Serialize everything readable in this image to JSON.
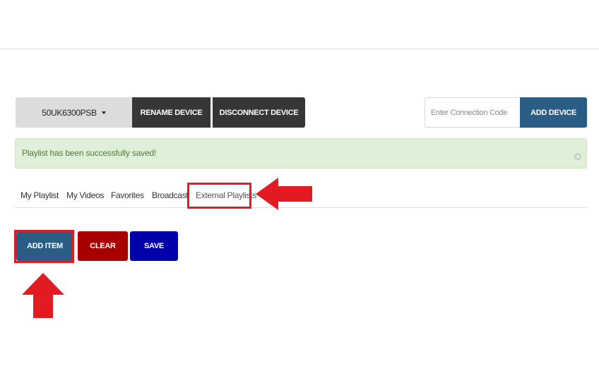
{
  "toolbar": {
    "device_name": "50UK6300PSB",
    "rename_label": "RENAME DEVICE",
    "disconnect_label": "DISCONNECT DEVICE",
    "connection_placeholder": "Enter Connection Code",
    "connection_value": "",
    "add_device_label": "ADD DEVICE"
  },
  "alert": {
    "message": "Playlist has been successfully saved!"
  },
  "tabs": [
    {
      "label": "My Playlist"
    },
    {
      "label": "My Videos"
    },
    {
      "label": "Favorites"
    },
    {
      "label": "Broadcast"
    },
    {
      "label": "External Playlists",
      "active": true
    }
  ],
  "actions": {
    "add_item_label": "ADD ITEM",
    "clear_label": "CLEAR",
    "save_label": "SAVE"
  },
  "colors": {
    "primary_blue": "#2a5d85",
    "dark": "#363636",
    "clear_red": "#a60000",
    "save_blue": "#0000a8",
    "alert_bg": "#dff0d8",
    "highlight_red": "#e21b23"
  }
}
